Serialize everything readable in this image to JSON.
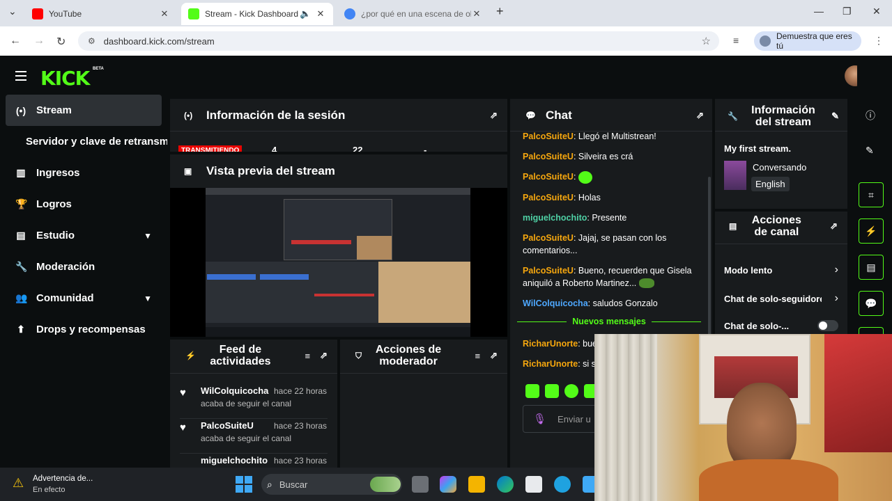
{
  "browser": {
    "tabs": [
      {
        "title": "YouTube",
        "favicon_color": "#ff0000",
        "active": false
      },
      {
        "title": "Stream - Kick Dashboard",
        "favicon_color": "#53fc18",
        "active": true
      },
      {
        "title": "¿por qué en una escena de obs",
        "favicon_color": "#4285f4",
        "active": false
      }
    ],
    "url": "dashboard.kick.com/stream",
    "profile_label": "Demuestra que eres tú"
  },
  "app": {
    "logo_text": "KICK",
    "beta_label": "BETA",
    "sidebar": {
      "items": [
        {
          "label": "Stream",
          "icon": "broadcast-icon",
          "active": true
        },
        {
          "label": "Servidor y clave de retransmisión",
          "sub": true
        },
        {
          "label": "Ingresos",
          "icon": "chart-icon"
        },
        {
          "label": "Logros",
          "icon": "trophy-icon"
        },
        {
          "label": "Estudio",
          "icon": "studio-icon",
          "expandable": true
        },
        {
          "label": "Moderación",
          "icon": "wrench-icon"
        },
        {
          "label": "Comunidad",
          "icon": "community-icon",
          "expandable": true
        },
        {
          "label": "Drops y recompensas",
          "icon": "drops-icon"
        }
      ]
    },
    "session": {
      "title": "Información de la sesión",
      "live_badge": "TRANSMITIENDO",
      "stat1": "4",
      "stat2": "22",
      "stat3": "-"
    },
    "preview": {
      "title": "Vista previa del stream"
    },
    "activity": {
      "title": "Feed de actividades",
      "items": [
        {
          "user": "WilColquicocha",
          "time": "hace 22 horas",
          "action": "acaba de seguir el canal"
        },
        {
          "user": "PalcoSuiteU",
          "time": "hace 23 horas",
          "action": "acaba de seguir el canal"
        },
        {
          "user": "miguelchochito",
          "time": "hace 23 horas",
          "action": ""
        }
      ]
    },
    "mod_actions": {
      "title": "Acciones de moderador"
    },
    "chat": {
      "title": "Chat",
      "messages": [
        {
          "user": "PalcoSuiteU",
          "color": "#f6a70e",
          "text": "Llegó el Multistrean!"
        },
        {
          "user": "PalcoSuiteU",
          "color": "#f6a70e",
          "text": "Silveira es crá"
        },
        {
          "user": "PalcoSuiteU",
          "color": "#f6a70e",
          "text": ""
        },
        {
          "user": "PalcoSuiteU",
          "color": "#f6a70e",
          "text": "Holas"
        },
        {
          "user": "miguelchochito",
          "color": "#4fd1a5",
          "text": "Presente"
        },
        {
          "user": "PalcoSuiteU",
          "color": "#f6a70e",
          "text": "Jajaj, se pasan con los comentarios..."
        },
        {
          "user": "PalcoSuiteU",
          "color": "#f6a70e",
          "text": "Bueno, recuerden que Gisela aniquiló a Roberto Martinez..."
        },
        {
          "user": "WilColquicocha",
          "color": "#4ea8ff",
          "text": "saludos Gonzalo"
        }
      ],
      "new_messages_label": "Nuevos mensajes",
      "new_messages": [
        {
          "user": "RicharUnorte",
          "color": "#f6a70e",
          "text": "bue"
        },
        {
          "user": "RicharUnorte",
          "color": "#f6a70e",
          "text": "si s"
        }
      ],
      "input_placeholder": "Enviar u"
    },
    "stream_info": {
      "title": "Información del stream",
      "stream_title": "My first stream.",
      "category": "Conversando",
      "language": "English"
    },
    "channel_actions": {
      "title": "Acciones de canal",
      "items": [
        {
          "label": "Modo lento"
        },
        {
          "label": "Chat de solo-seguidores"
        },
        {
          "label": "Chat de solo-..."
        }
      ]
    }
  },
  "taskbar": {
    "weather_title": "Advertencia de...",
    "weather_sub": "En efecto",
    "search_placeholder": "Buscar"
  },
  "colors": {
    "accent": "#53fc18",
    "bg": "#0b0e0f",
    "panel": "#181b1d",
    "live": "#eb0400"
  }
}
